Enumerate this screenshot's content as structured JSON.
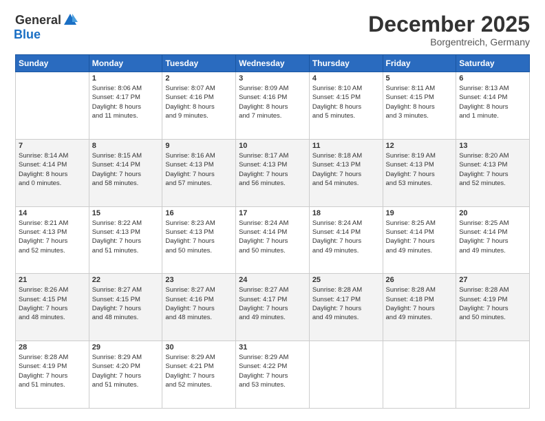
{
  "header": {
    "logo_general": "General",
    "logo_blue": "Blue",
    "month": "December 2025",
    "location": "Borgentreich, Germany"
  },
  "days_header": [
    "Sunday",
    "Monday",
    "Tuesday",
    "Wednesday",
    "Thursday",
    "Friday",
    "Saturday"
  ],
  "weeks": [
    [
      {
        "day": "",
        "lines": []
      },
      {
        "day": "1",
        "lines": [
          "Sunrise: 8:06 AM",
          "Sunset: 4:17 PM",
          "Daylight: 8 hours",
          "and 11 minutes."
        ]
      },
      {
        "day": "2",
        "lines": [
          "Sunrise: 8:07 AM",
          "Sunset: 4:16 PM",
          "Daylight: 8 hours",
          "and 9 minutes."
        ]
      },
      {
        "day": "3",
        "lines": [
          "Sunrise: 8:09 AM",
          "Sunset: 4:16 PM",
          "Daylight: 8 hours",
          "and 7 minutes."
        ]
      },
      {
        "day": "4",
        "lines": [
          "Sunrise: 8:10 AM",
          "Sunset: 4:15 PM",
          "Daylight: 8 hours",
          "and 5 minutes."
        ]
      },
      {
        "day": "5",
        "lines": [
          "Sunrise: 8:11 AM",
          "Sunset: 4:15 PM",
          "Daylight: 8 hours",
          "and 3 minutes."
        ]
      },
      {
        "day": "6",
        "lines": [
          "Sunrise: 8:13 AM",
          "Sunset: 4:14 PM",
          "Daylight: 8 hours",
          "and 1 minute."
        ]
      }
    ],
    [
      {
        "day": "7",
        "lines": [
          "Sunrise: 8:14 AM",
          "Sunset: 4:14 PM",
          "Daylight: 8 hours",
          "and 0 minutes."
        ]
      },
      {
        "day": "8",
        "lines": [
          "Sunrise: 8:15 AM",
          "Sunset: 4:14 PM",
          "Daylight: 7 hours",
          "and 58 minutes."
        ]
      },
      {
        "day": "9",
        "lines": [
          "Sunrise: 8:16 AM",
          "Sunset: 4:13 PM",
          "Daylight: 7 hours",
          "and 57 minutes."
        ]
      },
      {
        "day": "10",
        "lines": [
          "Sunrise: 8:17 AM",
          "Sunset: 4:13 PM",
          "Daylight: 7 hours",
          "and 56 minutes."
        ]
      },
      {
        "day": "11",
        "lines": [
          "Sunrise: 8:18 AM",
          "Sunset: 4:13 PM",
          "Daylight: 7 hours",
          "and 54 minutes."
        ]
      },
      {
        "day": "12",
        "lines": [
          "Sunrise: 8:19 AM",
          "Sunset: 4:13 PM",
          "Daylight: 7 hours",
          "and 53 minutes."
        ]
      },
      {
        "day": "13",
        "lines": [
          "Sunrise: 8:20 AM",
          "Sunset: 4:13 PM",
          "Daylight: 7 hours",
          "and 52 minutes."
        ]
      }
    ],
    [
      {
        "day": "14",
        "lines": [
          "Sunrise: 8:21 AM",
          "Sunset: 4:13 PM",
          "Daylight: 7 hours",
          "and 52 minutes."
        ]
      },
      {
        "day": "15",
        "lines": [
          "Sunrise: 8:22 AM",
          "Sunset: 4:13 PM",
          "Daylight: 7 hours",
          "and 51 minutes."
        ]
      },
      {
        "day": "16",
        "lines": [
          "Sunrise: 8:23 AM",
          "Sunset: 4:13 PM",
          "Daylight: 7 hours",
          "and 50 minutes."
        ]
      },
      {
        "day": "17",
        "lines": [
          "Sunrise: 8:24 AM",
          "Sunset: 4:14 PM",
          "Daylight: 7 hours",
          "and 50 minutes."
        ]
      },
      {
        "day": "18",
        "lines": [
          "Sunrise: 8:24 AM",
          "Sunset: 4:14 PM",
          "Daylight: 7 hours",
          "and 49 minutes."
        ]
      },
      {
        "day": "19",
        "lines": [
          "Sunrise: 8:25 AM",
          "Sunset: 4:14 PM",
          "Daylight: 7 hours",
          "and 49 minutes."
        ]
      },
      {
        "day": "20",
        "lines": [
          "Sunrise: 8:25 AM",
          "Sunset: 4:14 PM",
          "Daylight: 7 hours",
          "and 49 minutes."
        ]
      }
    ],
    [
      {
        "day": "21",
        "lines": [
          "Sunrise: 8:26 AM",
          "Sunset: 4:15 PM",
          "Daylight: 7 hours",
          "and 48 minutes."
        ]
      },
      {
        "day": "22",
        "lines": [
          "Sunrise: 8:27 AM",
          "Sunset: 4:15 PM",
          "Daylight: 7 hours",
          "and 48 minutes."
        ]
      },
      {
        "day": "23",
        "lines": [
          "Sunrise: 8:27 AM",
          "Sunset: 4:16 PM",
          "Daylight: 7 hours",
          "and 48 minutes."
        ]
      },
      {
        "day": "24",
        "lines": [
          "Sunrise: 8:27 AM",
          "Sunset: 4:17 PM",
          "Daylight: 7 hours",
          "and 49 minutes."
        ]
      },
      {
        "day": "25",
        "lines": [
          "Sunrise: 8:28 AM",
          "Sunset: 4:17 PM",
          "Daylight: 7 hours",
          "and 49 minutes."
        ]
      },
      {
        "day": "26",
        "lines": [
          "Sunrise: 8:28 AM",
          "Sunset: 4:18 PM",
          "Daylight: 7 hours",
          "and 49 minutes."
        ]
      },
      {
        "day": "27",
        "lines": [
          "Sunrise: 8:28 AM",
          "Sunset: 4:19 PM",
          "Daylight: 7 hours",
          "and 50 minutes."
        ]
      }
    ],
    [
      {
        "day": "28",
        "lines": [
          "Sunrise: 8:28 AM",
          "Sunset: 4:19 PM",
          "Daylight: 7 hours",
          "and 51 minutes."
        ]
      },
      {
        "day": "29",
        "lines": [
          "Sunrise: 8:29 AM",
          "Sunset: 4:20 PM",
          "Daylight: 7 hours",
          "and 51 minutes."
        ]
      },
      {
        "day": "30",
        "lines": [
          "Sunrise: 8:29 AM",
          "Sunset: 4:21 PM",
          "Daylight: 7 hours",
          "and 52 minutes."
        ]
      },
      {
        "day": "31",
        "lines": [
          "Sunrise: 8:29 AM",
          "Sunset: 4:22 PM",
          "Daylight: 7 hours",
          "and 53 minutes."
        ]
      },
      {
        "day": "",
        "lines": []
      },
      {
        "day": "",
        "lines": []
      },
      {
        "day": "",
        "lines": []
      }
    ]
  ]
}
